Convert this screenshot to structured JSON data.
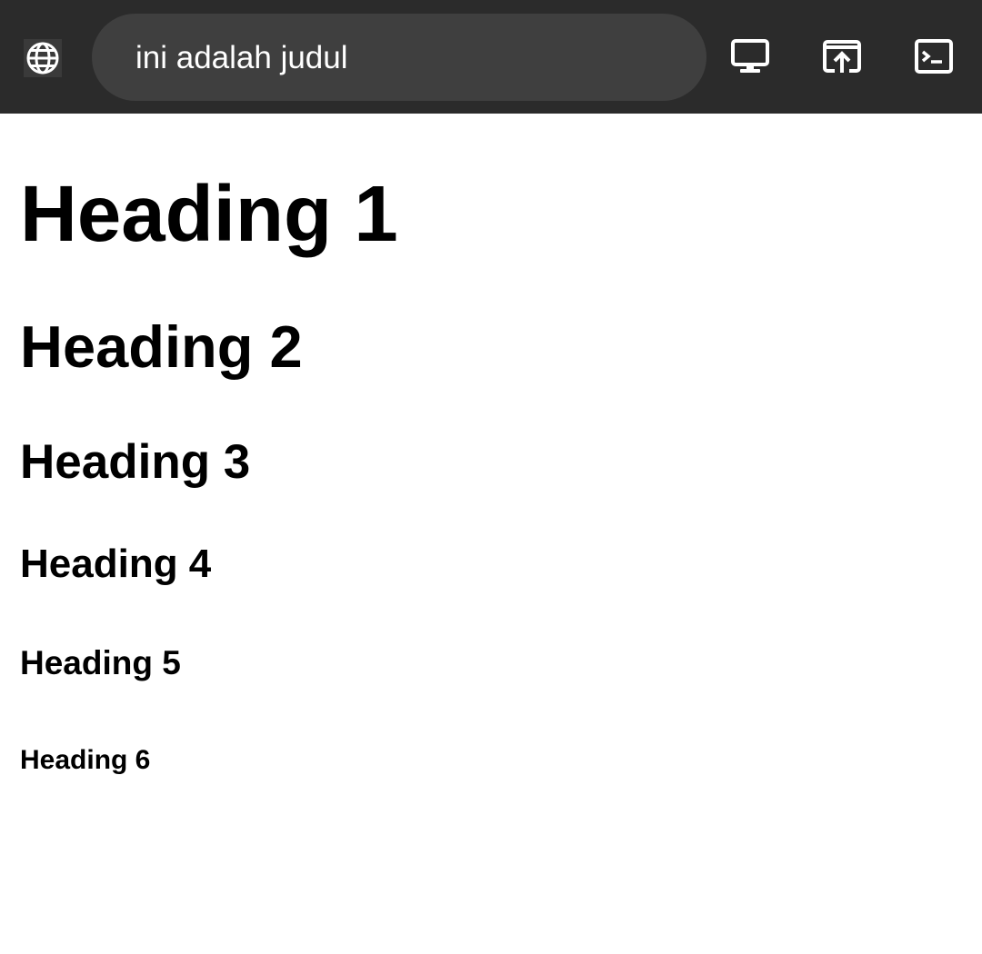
{
  "toolbar": {
    "site_icon": "globe-icon",
    "address_text": "ini adalah judul",
    "buttons": [
      {
        "icon": "monitor-icon"
      },
      {
        "icon": "open-external-icon"
      },
      {
        "icon": "terminal-icon"
      }
    ],
    "background": "#2b2b2b",
    "address_background": "#3f3f3f"
  },
  "content": {
    "headings": [
      "Heading 1",
      "Heading 2",
      "Heading 3",
      "Heading 4",
      "Heading 5",
      "Heading 6"
    ]
  }
}
